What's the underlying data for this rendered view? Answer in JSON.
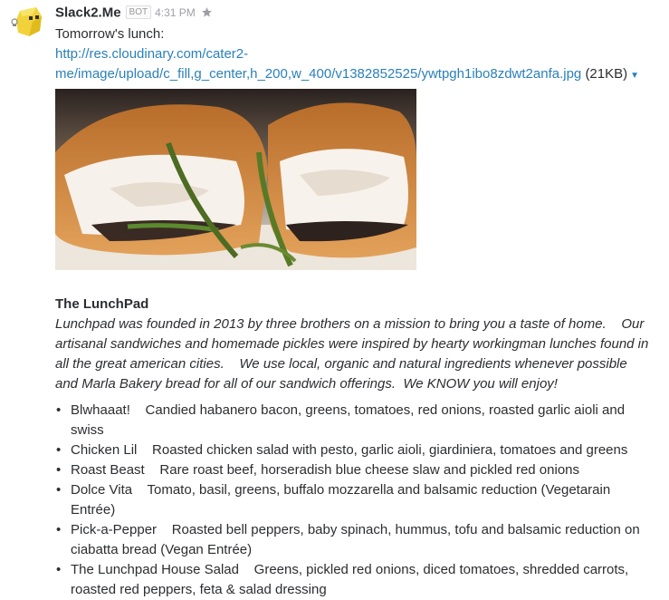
{
  "message": {
    "sender": "Slack2.Me",
    "badge": "BOT",
    "time": "4:31 PM",
    "intro": "Tomorrow's lunch:",
    "link_line1": "http://res.cloudinary.com/cater2-",
    "link_line2": "me/image/upload/c_fill,g_center,h_200,w_400/v1382852525/ywtpgh1ibo8zdwt2anfa.jpg",
    "file_size": "(21KB)",
    "icons": {
      "avatar": "bot-avatar-icon",
      "star": "star-icon",
      "caret": "caret-down-icon"
    }
  },
  "lunchpad": {
    "title": "The LunchPad",
    "description": "Lunchpad was founded in 2013 by three brothers on a mission to bring you a taste of home.    Our artisanal sandwiches and homemade pickles were inspired by hearty workingman lunches found in all the great american cities.    We use local, organic and natural ingredients whenever possible and Marla Bakery bread for all of our sandwich offerings.  We KNOW you will enjoy!"
  },
  "menu": [
    {
      "name": "Blwhaaat!",
      "desc": "Candied habanero bacon, greens, tomatoes, red onions, roasted garlic aioli and swiss"
    },
    {
      "name": "Chicken Lil",
      "desc": "Roasted chicken salad with pesto, garlic aioli, giardiniera, tomatoes and greens"
    },
    {
      "name": "Roast Beast",
      "desc": "Rare roast beef, horseradish blue cheese slaw and pickled red onions"
    },
    {
      "name": "Dolce Vita",
      "desc": "Tomato, basil, greens, buffalo mozzarella and balsamic reduction (Vegetarain Entrée)"
    },
    {
      "name": "Pick-a-Pepper",
      "desc": "Roasted bell peppers, baby spinach, hummus, tofu and balsamic reduction on ciabatta bread (Vegan Entrée)"
    },
    {
      "name": "The Lunchpad House Salad",
      "desc": "Greens, pickled red onions, diced tomatoes, shredded carrots, roasted red peppers, feta & salad dressing"
    }
  ],
  "colors": {
    "link": "#2a80b9",
    "text": "#2c2d30",
    "muted": "#9e9ea6",
    "avatar": "#f2d23b"
  }
}
